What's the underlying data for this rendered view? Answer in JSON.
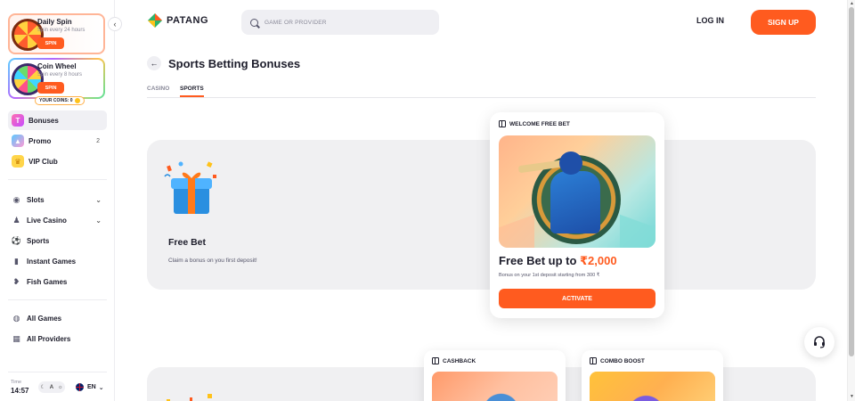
{
  "sidebar": {
    "daily_spin": {
      "title": "Daily Spin",
      "subtitle": "Spin every 24 hours",
      "button": "SPIN"
    },
    "coin_wheel": {
      "title": "Coin Wheel",
      "subtitle": "Spin every 8 hours",
      "button": "SPIN",
      "coins_label": "YOUR COINS: 0"
    },
    "nav_top": [
      {
        "label": "Bonuses",
        "icon": "bonus-icon",
        "active": true
      },
      {
        "label": "Promo",
        "icon": "promo-icon",
        "count": "2"
      },
      {
        "label": "VIP Club",
        "icon": "crown-icon"
      }
    ],
    "nav_games": [
      {
        "label": "Slots",
        "icon": "slots-icon",
        "expandable": true
      },
      {
        "label": "Live Casino",
        "icon": "live-casino-icon",
        "expandable": true
      },
      {
        "label": "Sports",
        "icon": "sports-icon"
      },
      {
        "label": "Instant Games",
        "icon": "instant-games-icon"
      },
      {
        "label": "Fish Games",
        "icon": "fish-icon"
      }
    ],
    "nav_bottom": [
      {
        "label": "All Games",
        "icon": "all-games-icon"
      },
      {
        "label": "All Providers",
        "icon": "providers-icon"
      }
    ],
    "footer": {
      "time_label": "Time",
      "time_value": "14:57",
      "theme_mode": "A",
      "language": "EN"
    }
  },
  "header": {
    "logo_text": "PATANG",
    "search_placeholder": "GAME OR PROVIDER",
    "login_label": "LOG IN",
    "signup_label": "SIGN UP"
  },
  "page": {
    "title": "Sports Betting Bonuses",
    "tabs": [
      {
        "label": "CASINO",
        "active": false
      },
      {
        "label": "SPORTS",
        "active": true
      }
    ]
  },
  "bonus_section": {
    "title": "Free Bet",
    "description": "Claim a bonus on you first deposit!",
    "featured_card": {
      "header": "WELCOME FREE BET",
      "headline_prefix": "Free Bet up to ",
      "headline_amount": "₹2,000",
      "description": "Bonus on your 1st deposit starting from 300 ₹",
      "button": "ACTIVATE"
    }
  },
  "bonus_cards": [
    {
      "header": "CASHBACK"
    },
    {
      "header": "COMBO BOOST"
    }
  ],
  "colors": {
    "accent": "#ff5b1f",
    "panel": "#f0f0f2",
    "text": "#1d1d2b"
  }
}
